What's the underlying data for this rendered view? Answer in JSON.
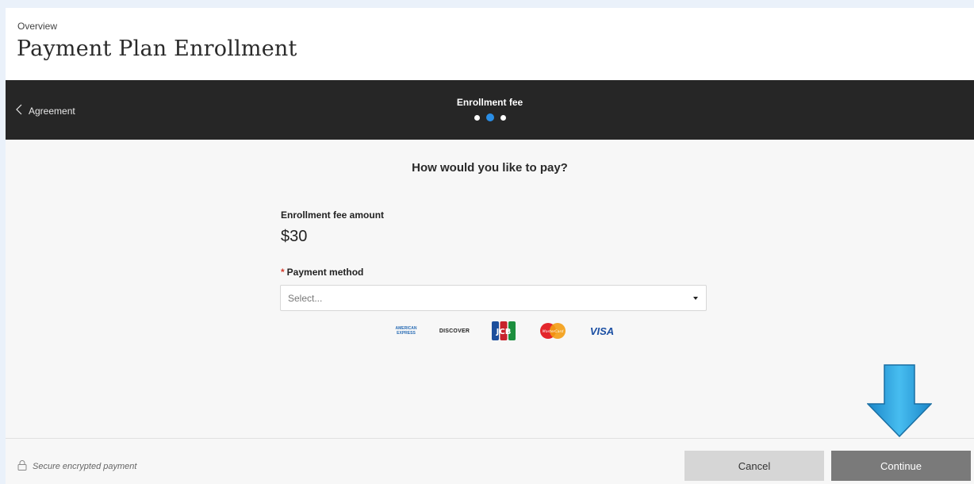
{
  "header": {
    "breadcrumb": "Overview",
    "title": "Payment Plan Enrollment"
  },
  "stepbar": {
    "back_label": "Agreement",
    "step_title": "Enrollment fee",
    "steps_total": 3,
    "active_step": 2
  },
  "main": {
    "question": "How would you like to pay?",
    "fee_label": "Enrollment fee amount",
    "fee_amount": "$30",
    "payment_method_label": "Payment method",
    "payment_method_placeholder": "Select...",
    "card_logos": [
      {
        "name": "amex",
        "text_line1": "AMERICAN",
        "text_line2": "EXPRESS"
      },
      {
        "name": "discover",
        "text": "DISCOVER"
      },
      {
        "name": "jcb",
        "text": "JCB"
      },
      {
        "name": "mastercard",
        "text": "MasterCard"
      },
      {
        "name": "visa",
        "text": "VISA"
      }
    ]
  },
  "footer": {
    "secure_text": "Secure encrypted payment",
    "cancel_label": "Cancel",
    "continue_label": "Continue"
  },
  "colors": {
    "accent_blue": "#2a8ee6",
    "stepbar_bg": "#262626",
    "continue_bg": "#7a7a7a",
    "cancel_bg": "#d6d6d6",
    "required_star": "#d23b2c",
    "annotation_arrow": "#2ea3dc"
  },
  "icons": {
    "back": "chevron-left-icon",
    "lock": "lock-icon",
    "select_caret": "caret-down-icon",
    "annotation": "arrow-down-icon"
  }
}
